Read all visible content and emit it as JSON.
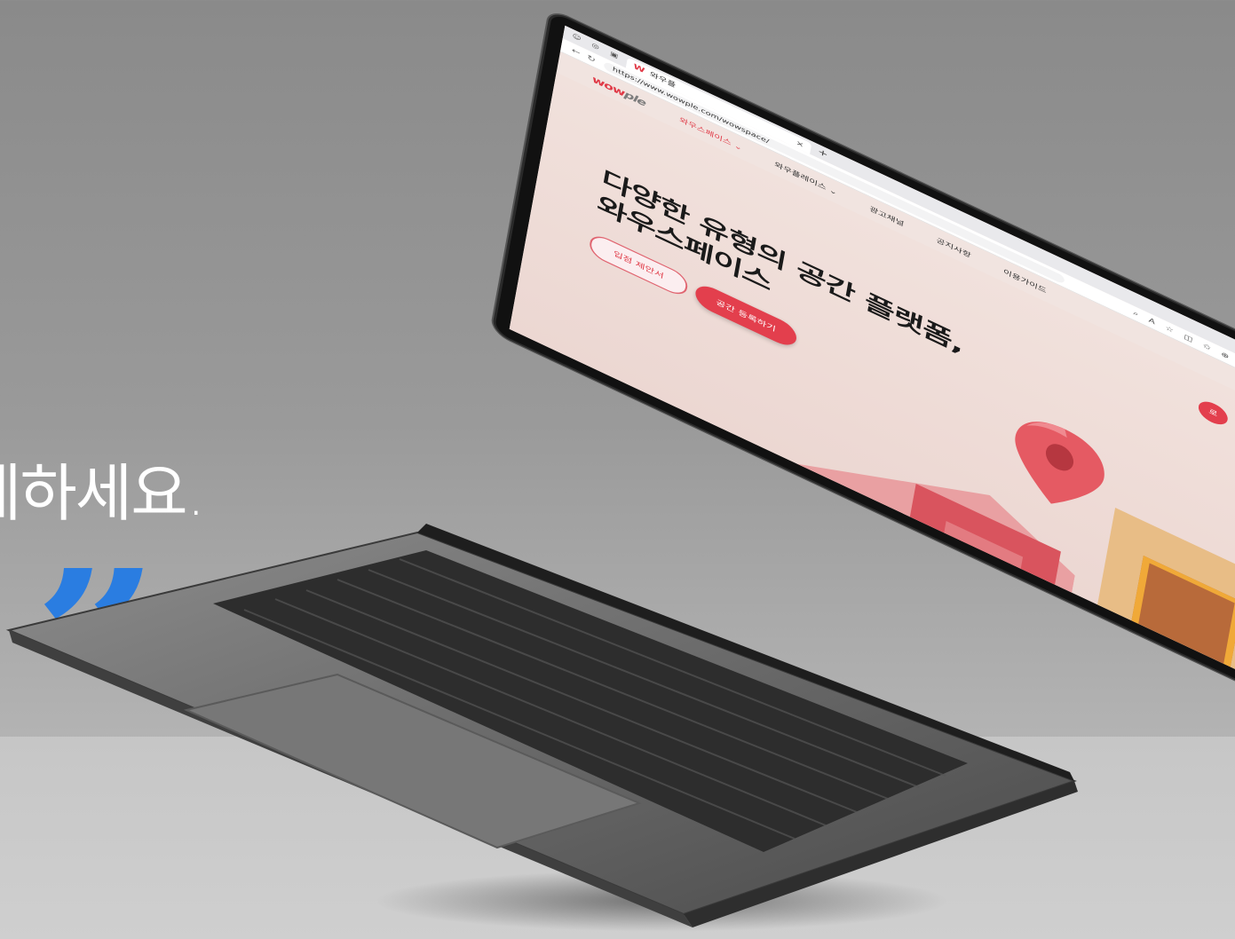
{
  "background_text": {
    "headline": "세하세요.",
    "quote_mark": "”"
  },
  "browser": {
    "tab_title": "와우플",
    "url": "https://www.wowple.com/wowspace/",
    "new_tab": "+",
    "close_tab": "×",
    "window_controls": [
      "–",
      "□",
      "×"
    ]
  },
  "site": {
    "logo_prefix": "wow",
    "logo_suffix": "ple",
    "nav": [
      "와우스페이스 ⌄",
      "와우플레이스 ⌄",
      "광고채널",
      "공지사항",
      "이용가이드"
    ],
    "hero_title_line1": "다양한 유형의 공간 플랫폼,",
    "hero_title_line2": "와우스페이스",
    "button_outline": "입점 제안서",
    "button_fill": "공간 등록하기",
    "badge": "로"
  },
  "colors": {
    "accent": "#e33f4d",
    "quote": "#2a7de1",
    "hero_bg": "#f1e1dc"
  },
  "icons": [
    "profile-icon",
    "tabs-icon",
    "back-icon",
    "refresh-icon",
    "lock-icon",
    "zoom-icon",
    "read-aloud-icon",
    "favorite-icon",
    "split-icon",
    "favorites-bar-icon",
    "collections-icon",
    "extensions-icon",
    "more-icon",
    "bing-icon",
    "map-pin-icon"
  ]
}
